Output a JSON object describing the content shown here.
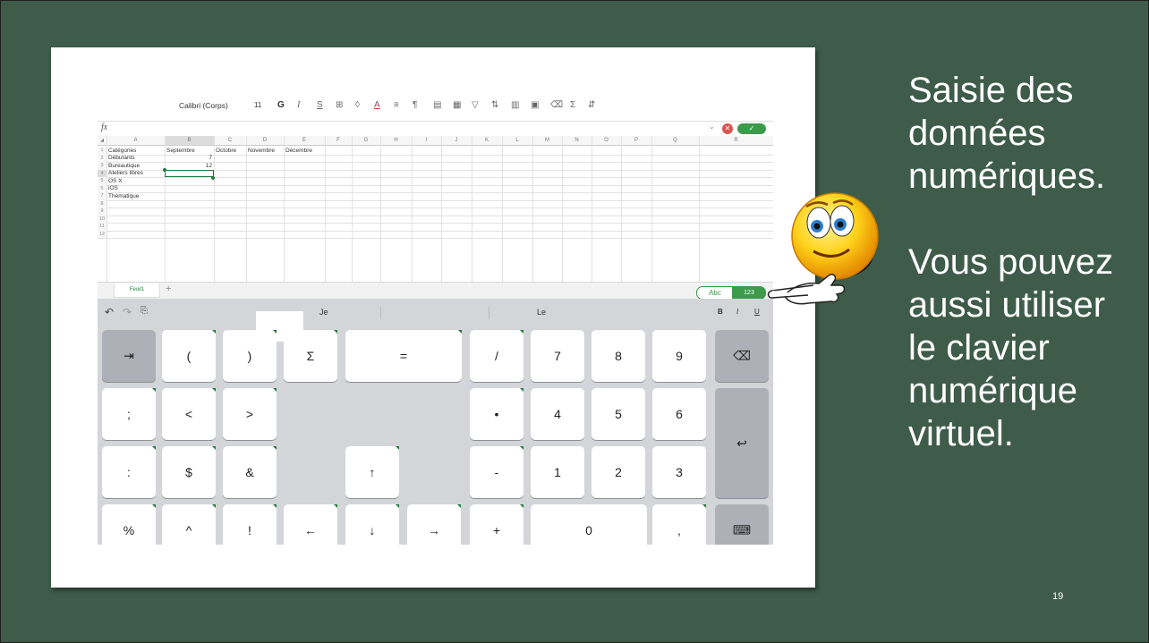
{
  "ribbon": {
    "font": "Calibri (Corps)",
    "size": "11",
    "icons": [
      "bold-icon",
      "italic-icon",
      "underline-icon",
      "borders-icon",
      "fill-color-icon",
      "font-color-icon",
      "align-icon",
      "paragraph-icon",
      "merge-icon",
      "wrap-icon",
      "filter-icon",
      "sort-icon",
      "table-icon",
      "print-icon",
      "eraser-icon",
      "sum-icon",
      "sort-filter-icon"
    ],
    "bold": "G",
    "italic": "I",
    "underline": "S",
    "sum": "Σ"
  },
  "formula_bar": {
    "fx": "fx",
    "value": ""
  },
  "columns": [
    "A",
    "B",
    "C",
    "D",
    "E",
    "F",
    "G",
    "H",
    "I",
    "J",
    "K",
    "L",
    "M",
    "N",
    "O",
    "P",
    "Q",
    "R"
  ],
  "rows": [
    "1",
    "2",
    "3",
    "4",
    "5",
    "6",
    "7",
    "8",
    "9",
    "10",
    "11",
    "12"
  ],
  "cells": {
    "A1": "Catégories",
    "B1": "Septembre",
    "C1": "Octobre",
    "D1": "Novembre",
    "E1": "Décembre",
    "A2": "Débutants",
    "B2": "7",
    "A3": "Bureautique",
    "B3": "12",
    "A4": "Ateliers libres",
    "A5": "OS X",
    "A6": "iOS",
    "A7": "Thématique"
  },
  "sheet_tab": "Feuil1",
  "add_sheet": "+",
  "mode_toggle": {
    "abc": "Abc",
    "num": "123"
  },
  "suggestions": [
    "Je",
    "Le"
  ],
  "format_buttons": [
    "B",
    "I",
    "U"
  ],
  "keys": {
    "row1": [
      "⇥",
      "(",
      ")",
      "Σ",
      "=",
      "/",
      "7",
      "8",
      "9",
      "⌫"
    ],
    "row2": [
      ";",
      "<",
      ">",
      "•",
      "4",
      "5",
      "6",
      "↩"
    ],
    "row3": [
      ":",
      "$",
      "&",
      "↑",
      "-",
      "1",
      "2",
      "3"
    ],
    "row4": [
      "%",
      "^",
      "!",
      "←",
      "↓",
      "→",
      "+",
      "0",
      ","
    ]
  },
  "slide_text": {
    "line1": [
      "Saisie des",
      "données",
      "numériques."
    ],
    "line2": [
      "Vous pouvez",
      "aussi utiliser",
      "le clavier",
      "numérique",
      "virtuel."
    ]
  },
  "page_number": "19",
  "colors": {
    "slide_bg": "#3e5c49",
    "excel_green": "#1f7a3d",
    "keyboard_bg": "#d3d5d8"
  }
}
